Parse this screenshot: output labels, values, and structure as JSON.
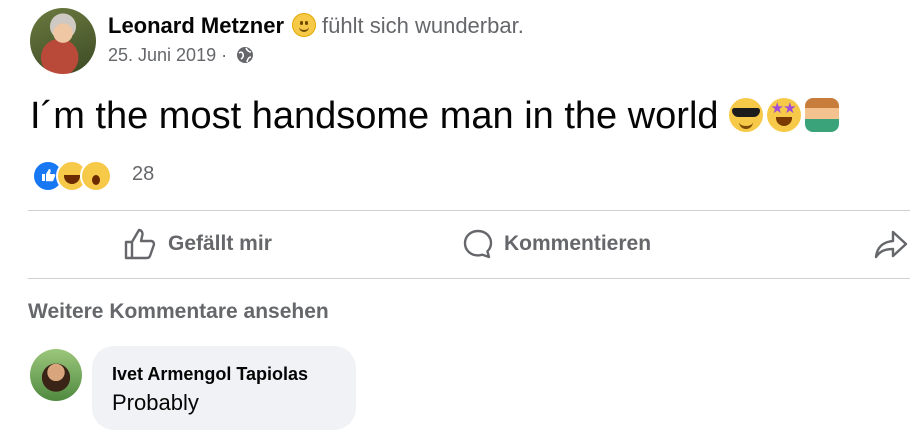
{
  "post": {
    "author_name": "Leonard Metzner",
    "feeling_icon": "slightly-smiling-face-icon",
    "feeling_text": "fühlt sich wunderbar.",
    "date": "25. Juni 2019",
    "separator": "·",
    "audience_icon": "globe-icon",
    "text": "I´m the most handsome man in the world",
    "text_emojis": [
      "sunglasses-face-emoji",
      "star-struck-emoji",
      "man-tipping-hand-emoji"
    ]
  },
  "reactions": {
    "icons": [
      "like-reaction-icon",
      "haha-reaction-icon",
      "wow-reaction-icon"
    ],
    "count": "28"
  },
  "actions": {
    "like_label": "Gefällt mir",
    "comment_label": "Kommentieren",
    "share_icon": "share-arrow-icon"
  },
  "comments": {
    "more_label": "Weitere Kommentare ansehen",
    "items": [
      {
        "author": "Ivet Armengol Tapiolas",
        "text": "Probably"
      }
    ]
  },
  "colors": {
    "secondary_text": "#65676b",
    "primary_text": "#050505",
    "like_blue": "#1877f2",
    "bubble_bg": "#f0f2f5",
    "divider": "#ced0d4"
  }
}
